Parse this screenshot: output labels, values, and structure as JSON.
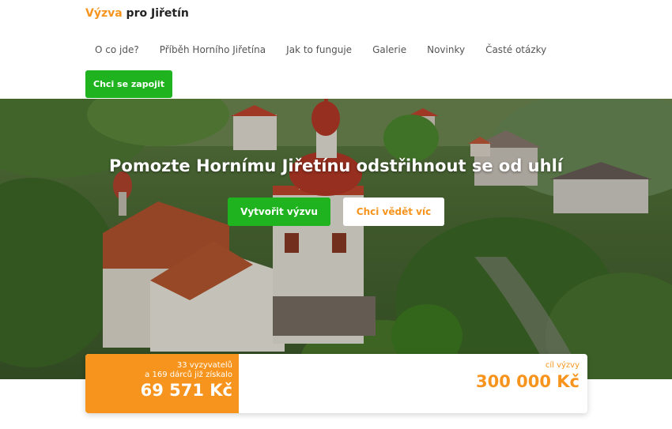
{
  "header": {
    "logo_part1": "Výzva",
    "logo_part2": " pro Jiřetín",
    "nav": [
      "O co jde?",
      "Příběh Horního Jiřetína",
      "Jak to funguje",
      "Galerie",
      "Novinky",
      "Časté otázky"
    ],
    "cta_label": "Chci se zapojit"
  },
  "hero": {
    "title": "Pomozte Hornímu Jiřetínu odstřihnout se od uhlí",
    "primary_button": "Vytvořit výzvu",
    "secondary_button": "Chci vědět víc"
  },
  "stats": {
    "challengers": "33 vyzyvatelů",
    "donors": "a 169 dárců již získalo",
    "raised": "69 571 Kč",
    "goal_label": "cíl výzvy",
    "goal_value": "300 000 Kč"
  },
  "colors": {
    "accent_orange": "#f7941d",
    "accent_green": "#1fb41f"
  }
}
